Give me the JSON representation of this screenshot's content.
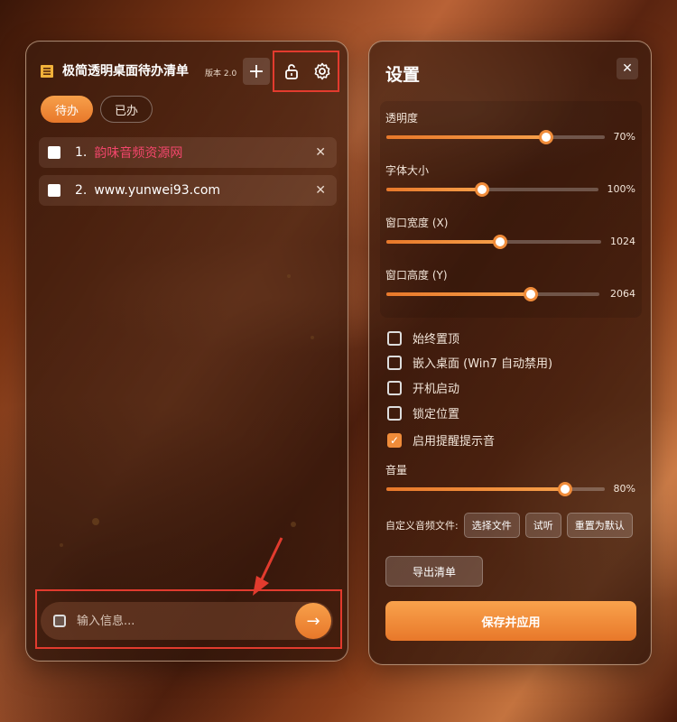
{
  "app": {
    "title": "极简透明桌面待办清单",
    "version": "版本 2.0"
  },
  "tabs": [
    {
      "label": "待办",
      "active": true
    },
    {
      "label": "已办",
      "active": false
    }
  ],
  "todos": [
    {
      "num": "1.",
      "text": "韵味音频资源网",
      "highlight": "#f2466b"
    },
    {
      "num": "2.",
      "text": "www.yunwei93.com"
    }
  ],
  "input": {
    "placeholder": "输入信息..."
  },
  "settings": {
    "title": "设置",
    "sliders": [
      {
        "label": "透明度",
        "value_text": "70%",
        "level": 0.73
      },
      {
        "label": "字体大小",
        "value_text": "100%",
        "level": 0.45
      },
      {
        "label": "窗口宽度 (X)",
        "value_text": "1024",
        "level": 0.53
      },
      {
        "label": "窗口高度 (Y)",
        "value_text": "2064",
        "level": 0.68
      }
    ],
    "checkboxes": [
      {
        "label": "始终置顶",
        "checked": false
      },
      {
        "label": "嵌入桌面 (Win7 自动禁用)",
        "checked": false
      },
      {
        "label": "开机启动",
        "checked": false
      },
      {
        "label": "锁定位置",
        "checked": false
      },
      {
        "label": "启用提醒提示音",
        "checked": true
      }
    ],
    "volume": {
      "label": "音量",
      "value_text": "80%",
      "level": 0.82
    },
    "audio": {
      "label": "自定义音频文件:",
      "choose": "选择文件",
      "preview": "试听",
      "reset": "重置为默认"
    },
    "export_label": "导出清单",
    "save_label": "保存并应用"
  },
  "colors": {
    "accent": "#f08c3a",
    "highlight": "#e23b2e"
  }
}
